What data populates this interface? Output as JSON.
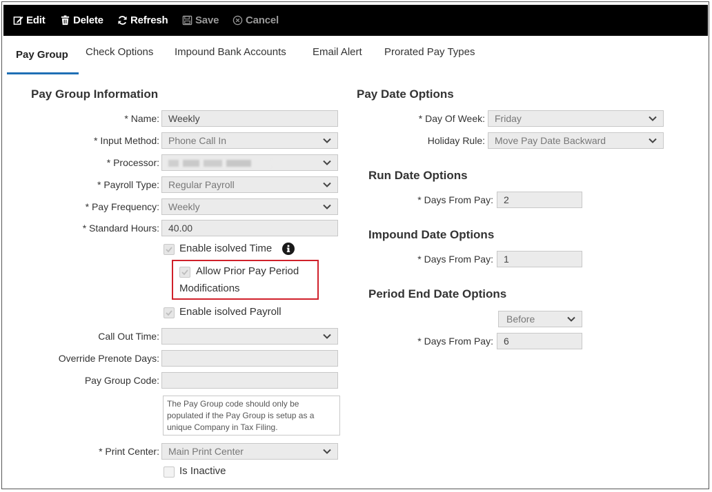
{
  "toolbar": {
    "edit": "Edit",
    "delete": "Delete",
    "refresh": "Refresh",
    "save": "Save",
    "cancel": "Cancel"
  },
  "tabs": [
    "Pay Group",
    "Check Options",
    "Impound Bank Accounts",
    "Email Alert",
    "Prorated Pay Types"
  ],
  "left": {
    "title": "Pay Group Information",
    "name_label": "* Name:",
    "name_value": "Weekly",
    "input_method_label": "* Input Method:",
    "input_method_value": "Phone Call In",
    "processor_label": "* Processor:",
    "payroll_type_label": "* Payroll Type:",
    "payroll_type_value": "Regular Payroll",
    "pay_frequency_label": "* Pay Frequency:",
    "pay_frequency_value": "Weekly",
    "standard_hours_label": "* Standard Hours:",
    "standard_hours_value": "40.00",
    "enable_time_label": "Enable isolved Time",
    "allow_prior_line1": "Allow Prior Pay Period",
    "allow_prior_line2": "Modifications",
    "enable_payroll_label": "Enable isolved Payroll",
    "call_out_time_label": "Call Out Time:",
    "override_prenote_label": "Override Prenote Days:",
    "pay_group_code_label": "Pay Group Code:",
    "pay_group_code_note": "The Pay Group code should only be populated if the Pay Group is setup as a unique Company in Tax Filing.",
    "print_center_label": "* Print Center:",
    "print_center_value": "Main Print Center",
    "is_inactive_label": "Is Inactive"
  },
  "right": {
    "pay_date_title": "Pay Date Options",
    "day_of_week_label": "* Day Of Week:",
    "day_of_week_value": "Friday",
    "holiday_rule_label": "Holiday Rule:",
    "holiday_rule_value": "Move Pay Date Backward",
    "run_date_title": "Run Date Options",
    "run_days_label": "* Days From Pay:",
    "run_days_value": "2",
    "impound_title": "Impound Date Options",
    "impound_days_label": "* Days From Pay:",
    "impound_days_value": "1",
    "period_end_title": "Period End Date Options",
    "period_end_when": "Before",
    "period_end_days_label": "* Days From Pay:",
    "period_end_days_value": "6"
  },
  "colors": {
    "toolbar_bg": "#000000",
    "tab_accent": "#1f6fb5",
    "highlight": "#d0202a"
  }
}
